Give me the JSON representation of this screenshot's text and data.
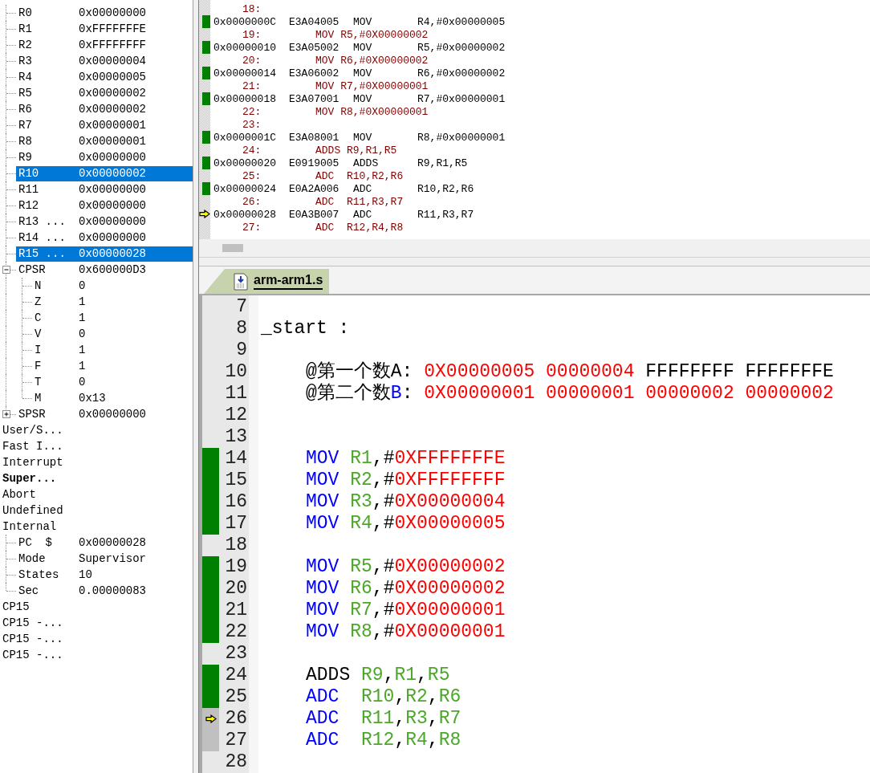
{
  "registers": {
    "items": [
      {
        "name": "R0",
        "value": "0x00000000",
        "selected": false
      },
      {
        "name": "R1",
        "value": "0xFFFFFFFE",
        "selected": false
      },
      {
        "name": "R2",
        "value": "0xFFFFFFFF",
        "selected": false
      },
      {
        "name": "R3",
        "value": "0x00000004",
        "selected": false
      },
      {
        "name": "R4",
        "value": "0x00000005",
        "selected": false
      },
      {
        "name": "R5",
        "value": "0x00000002",
        "selected": false
      },
      {
        "name": "R6",
        "value": "0x00000002",
        "selected": false
      },
      {
        "name": "R7",
        "value": "0x00000001",
        "selected": false
      },
      {
        "name": "R8",
        "value": "0x00000001",
        "selected": false
      },
      {
        "name": "R9",
        "value": "0x00000000",
        "selected": false
      },
      {
        "name": "R10",
        "value": "0x00000002",
        "selected": true
      },
      {
        "name": "R11",
        "value": "0x00000000",
        "selected": false
      },
      {
        "name": "R12",
        "value": "0x00000000",
        "selected": false
      },
      {
        "name": "R13 ...",
        "value": "0x00000000",
        "selected": false
      },
      {
        "name": "R14 ...",
        "value": "0x00000000",
        "selected": false
      },
      {
        "name": "R15 ...",
        "value": "0x00000028",
        "selected": true
      },
      {
        "name": "CPSR",
        "value": "0x600000D3",
        "selected": false,
        "expanded": true,
        "children": [
          {
            "name": "N",
            "value": "0",
            "selected": false
          },
          {
            "name": "Z",
            "value": "1",
            "selected": false
          },
          {
            "name": "C",
            "value": "1",
            "selected": false
          },
          {
            "name": "V",
            "value": "0",
            "selected": false
          },
          {
            "name": "I",
            "value": "1",
            "selected": false
          },
          {
            "name": "F",
            "value": "1",
            "selected": false
          },
          {
            "name": "T",
            "value": "0",
            "selected": false
          },
          {
            "name": "M",
            "value": "0x13",
            "selected": false
          }
        ]
      },
      {
        "name": "SPSR",
        "value": "0x00000000",
        "selected": false,
        "expanded": false
      }
    ]
  },
  "modes": [
    {
      "label": "User/S...",
      "current": false
    },
    {
      "label": "Fast I...",
      "current": false
    },
    {
      "label": "Interrupt",
      "current": false
    },
    {
      "label": "Super...",
      "current": true
    },
    {
      "label": "Abort",
      "current": false
    },
    {
      "label": "Undefined",
      "current": false
    },
    {
      "label": "Internal",
      "current": false,
      "children": [
        {
          "name": "PC  $",
          "value": "0x00000028",
          "selected": false
        },
        {
          "name": "Mode",
          "value": "Supervisor",
          "selected": false
        },
        {
          "name": "States",
          "value": "10",
          "selected": false
        },
        {
          "name": "Sec",
          "value": "0.00000083",
          "selected": false
        }
      ]
    },
    {
      "label": "CP15",
      "current": false
    },
    {
      "label": "CP15 -...",
      "current": false
    },
    {
      "label": "CP15 -...",
      "current": false
    },
    {
      "label": "CP15 -...",
      "current": false
    }
  ],
  "disassembly": [
    {
      "kind": "source",
      "number": "18:"
    },
    {
      "kind": "asm",
      "executed": true,
      "current": false,
      "address": "0x0000000C",
      "opcode": "E3A04005",
      "mnemonic": "MOV",
      "operands": "R4,#0x00000005"
    },
    {
      "kind": "source",
      "number": "19:",
      "code": "MOV R5,#0X00000002"
    },
    {
      "kind": "asm",
      "executed": true,
      "current": false,
      "address": "0x00000010",
      "opcode": "E3A05002",
      "mnemonic": "MOV",
      "operands": "R5,#0x00000002"
    },
    {
      "kind": "source",
      "number": "20:",
      "code": "MOV R6,#0X00000002"
    },
    {
      "kind": "asm",
      "executed": true,
      "current": false,
      "address": "0x00000014",
      "opcode": "E3A06002",
      "mnemonic": "MOV",
      "operands": "R6,#0x00000002"
    },
    {
      "kind": "source",
      "number": "21:",
      "code": "MOV R7,#0X00000001"
    },
    {
      "kind": "asm",
      "executed": true,
      "current": false,
      "address": "0x00000018",
      "opcode": "E3A07001",
      "mnemonic": "MOV",
      "operands": "R7,#0x00000001"
    },
    {
      "kind": "source",
      "number": "22:",
      "code": "MOV R8,#0X00000001"
    },
    {
      "kind": "source",
      "number": "23:"
    },
    {
      "kind": "asm",
      "executed": true,
      "current": false,
      "address": "0x0000001C",
      "opcode": "E3A08001",
      "mnemonic": "MOV",
      "operands": "R8,#0x00000001"
    },
    {
      "kind": "source",
      "number": "24:",
      "code": "ADDS R9,R1,R5"
    },
    {
      "kind": "asm",
      "executed": true,
      "current": false,
      "address": "0x00000020",
      "opcode": "E0919005",
      "mnemonic": "ADDS",
      "operands": "R9,R1,R5"
    },
    {
      "kind": "source",
      "number": "25:",
      "code": "ADC  R10,R2,R6"
    },
    {
      "kind": "asm",
      "executed": true,
      "current": false,
      "address": "0x00000024",
      "opcode": "E0A2A006",
      "mnemonic": "ADC",
      "operands": "R10,R2,R6"
    },
    {
      "kind": "source",
      "number": "26:",
      "code": "ADC  R11,R3,R7"
    },
    {
      "kind": "asm",
      "executed": false,
      "current": true,
      "address": "0x00000028",
      "opcode": "E0A3B007",
      "mnemonic": "ADC",
      "operands": "R11,R3,R7"
    },
    {
      "kind": "source",
      "number": "27:",
      "code": "ADC  R12,R4,R8"
    }
  ],
  "editor": {
    "tab": {
      "label": "arm-arm1.s",
      "selected": true
    },
    "lines": [
      {
        "number": "7",
        "kind": "blank",
        "executed": false,
        "current": false
      },
      {
        "number": "8",
        "kind": "label",
        "executed": false,
        "current": false,
        "tokens": [
          {
            "kind": "plain",
            "text": "_start :"
          }
        ]
      },
      {
        "number": "9",
        "kind": "blank",
        "executed": false,
        "current": false
      },
      {
        "number": "10",
        "kind": "comment",
        "executed": false,
        "current": false,
        "tokens": [
          {
            "kind": "plain",
            "text": "@第一个数A: "
          },
          {
            "kind": "number",
            "text": "0X00000005 00000004"
          },
          {
            "kind": "plain",
            "text": " FFFFFFFF FFFFFFFE"
          }
        ]
      },
      {
        "number": "11",
        "kind": "comment",
        "executed": false,
        "current": false,
        "tokens": [
          {
            "kind": "plain",
            "text": "@第二个数"
          },
          {
            "kind": "keyword",
            "text": "B"
          },
          {
            "kind": "plain",
            "text": ": "
          },
          {
            "kind": "number",
            "text": "0X00000001 00000001 00000002 00000002"
          }
        ]
      },
      {
        "number": "12",
        "kind": "blank",
        "executed": false,
        "current": false
      },
      {
        "number": "13",
        "kind": "blank",
        "executed": false,
        "current": false
      },
      {
        "number": "14",
        "kind": "statement",
        "executed": true,
        "current": false,
        "tokens": [
          {
            "kind": "keyword",
            "text": "MOV "
          },
          {
            "kind": "register",
            "text": "R1"
          },
          {
            "kind": "plain",
            "text": ",#"
          },
          {
            "kind": "number",
            "text": "0XFFFFFFFE"
          }
        ]
      },
      {
        "number": "15",
        "kind": "statement",
        "executed": true,
        "current": false,
        "tokens": [
          {
            "kind": "keyword",
            "text": "MOV "
          },
          {
            "kind": "register",
            "text": "R2"
          },
          {
            "kind": "plain",
            "text": ",#"
          },
          {
            "kind": "number",
            "text": "0XFFFFFFFF"
          }
        ]
      },
      {
        "number": "16",
        "kind": "statement",
        "executed": true,
        "current": false,
        "tokens": [
          {
            "kind": "keyword",
            "text": "MOV "
          },
          {
            "kind": "register",
            "text": "R3"
          },
          {
            "kind": "plain",
            "text": ",#"
          },
          {
            "kind": "number",
            "text": "0X00000004"
          }
        ]
      },
      {
        "number": "17",
        "kind": "statement",
        "executed": true,
        "current": false,
        "tokens": [
          {
            "kind": "keyword",
            "text": "MOV "
          },
          {
            "kind": "register",
            "text": "R4"
          },
          {
            "kind": "plain",
            "text": ",#"
          },
          {
            "kind": "number",
            "text": "0X00000005"
          }
        ]
      },
      {
        "number": "18",
        "kind": "blank",
        "executed": false,
        "current": false
      },
      {
        "number": "19",
        "kind": "statement",
        "executed": true,
        "current": false,
        "tokens": [
          {
            "kind": "keyword",
            "text": "MOV "
          },
          {
            "kind": "register",
            "text": "R5"
          },
          {
            "kind": "plain",
            "text": ",#"
          },
          {
            "kind": "number",
            "text": "0X00000002"
          }
        ]
      },
      {
        "number": "20",
        "kind": "statement",
        "executed": true,
        "current": false,
        "tokens": [
          {
            "kind": "keyword",
            "text": "MOV "
          },
          {
            "kind": "register",
            "text": "R6"
          },
          {
            "kind": "plain",
            "text": ",#"
          },
          {
            "kind": "number",
            "text": "0X00000002"
          }
        ]
      },
      {
        "number": "21",
        "kind": "statement",
        "executed": true,
        "current": false,
        "tokens": [
          {
            "kind": "keyword",
            "text": "MOV "
          },
          {
            "kind": "register",
            "text": "R7"
          },
          {
            "kind": "plain",
            "text": ",#"
          },
          {
            "kind": "number",
            "text": "0X00000001"
          }
        ]
      },
      {
        "number": "22",
        "kind": "statement",
        "executed": true,
        "current": false,
        "tokens": [
          {
            "kind": "keyword",
            "text": "MOV "
          },
          {
            "kind": "register",
            "text": "R8"
          },
          {
            "kind": "plain",
            "text": ",#"
          },
          {
            "kind": "number",
            "text": "0X00000001"
          }
        ]
      },
      {
        "number": "23",
        "kind": "blank",
        "executed": false,
        "current": false
      },
      {
        "number": "24",
        "kind": "statement",
        "executed": true,
        "current": false,
        "tokens": [
          {
            "kind": "plain",
            "text": "ADDS "
          },
          {
            "kind": "register",
            "text": "R9"
          },
          {
            "kind": "plain",
            "text": ","
          },
          {
            "kind": "register",
            "text": "R1"
          },
          {
            "kind": "plain",
            "text": ","
          },
          {
            "kind": "register",
            "text": "R5"
          }
        ]
      },
      {
        "number": "25",
        "kind": "statement",
        "executed": true,
        "current": false,
        "tokens": [
          {
            "kind": "keyword",
            "text": "ADC  "
          },
          {
            "kind": "register",
            "text": "R10"
          },
          {
            "kind": "plain",
            "text": ","
          },
          {
            "kind": "register",
            "text": "R2"
          },
          {
            "kind": "plain",
            "text": ","
          },
          {
            "kind": "register",
            "text": "R6"
          }
        ]
      },
      {
        "number": "26",
        "kind": "statement",
        "executed": false,
        "current": true,
        "tokens": [
          {
            "kind": "keyword",
            "text": "ADC  "
          },
          {
            "kind": "register",
            "text": "R11"
          },
          {
            "kind": "plain",
            "text": ","
          },
          {
            "kind": "register",
            "text": "R3"
          },
          {
            "kind": "plain",
            "text": ","
          },
          {
            "kind": "register",
            "text": "R7"
          }
        ]
      },
      {
        "number": "27",
        "kind": "statement",
        "executed": false,
        "current": false,
        "tokens": [
          {
            "kind": "keyword",
            "text": "ADC  "
          },
          {
            "kind": "register",
            "text": "R12"
          },
          {
            "kind": "plain",
            "text": ","
          },
          {
            "kind": "register",
            "text": "R4"
          },
          {
            "kind": "plain",
            "text": ","
          },
          {
            "kind": "register",
            "text": "R8"
          }
        ]
      },
      {
        "number": "28",
        "kind": "blank",
        "executed": false,
        "current": false
      }
    ]
  }
}
